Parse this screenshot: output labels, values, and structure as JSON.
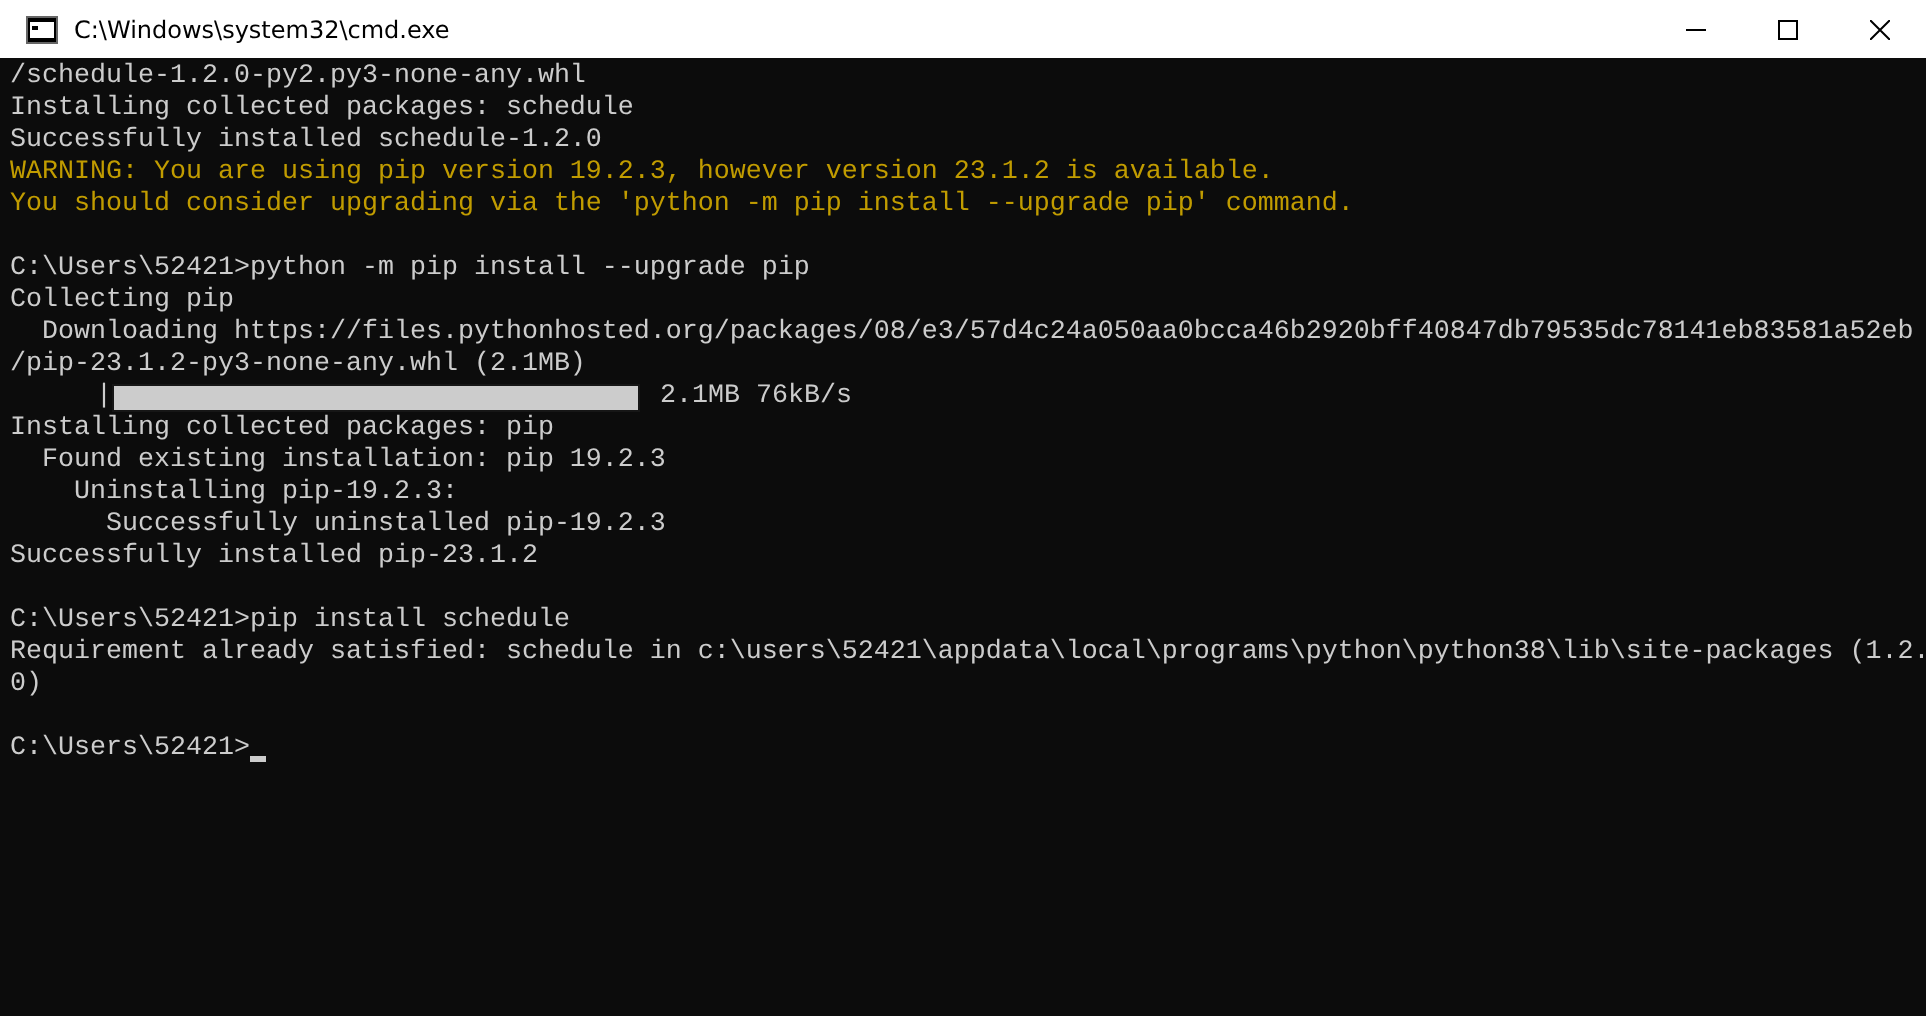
{
  "window": {
    "title": "C:\\Windows\\system32\\cmd.exe"
  },
  "lines": [
    {
      "kind": "output",
      "text": "/schedule-1.2.0-py2.py3-none-any.whl"
    },
    {
      "kind": "output",
      "text": "Installing collected packages: schedule"
    },
    {
      "kind": "output",
      "text": "Successfully installed schedule-1.2.0"
    },
    {
      "kind": "warning",
      "text": "WARNING: You are using pip version 19.2.3, however version 23.1.2 is available."
    },
    {
      "kind": "warning",
      "text": "You should consider upgrading via the 'python -m pip install --upgrade pip' command."
    },
    {
      "kind": "blank"
    },
    {
      "kind": "output",
      "text": "C:\\Users\\52421>python -m pip install --upgrade pip"
    },
    {
      "kind": "output",
      "text": "Collecting pip"
    },
    {
      "kind": "output",
      "text": "  Downloading https://files.pythonhosted.org/packages/08/e3/57d4c24a050aa0bcca46b2920bff40847db79535dc78141eb83581a52eb"
    },
    {
      "kind": "output",
      "text": "/pip-23.1.2-py3-none-any.whl (2.1MB)"
    },
    {
      "kind": "progress",
      "text": "|",
      "level": 1,
      "reading": "2.1MB 76kB/s"
    },
    {
      "kind": "output",
      "text": "Installing collected packages: pip"
    },
    {
      "kind": "output",
      "text": "  Found existing installation: pip 19.2.3"
    },
    {
      "kind": "output",
      "text": "    Uninstalling pip-19.2.3:"
    },
    {
      "kind": "output",
      "text": "      Successfully uninstalled pip-19.2.3"
    },
    {
      "kind": "output",
      "text": "Successfully installed pip-23.1.2"
    },
    {
      "kind": "blank"
    },
    {
      "kind": "output",
      "text": "C:\\Users\\52421>pip install schedule"
    },
    {
      "kind": "output",
      "text": "Requirement already satisfied: schedule in c:\\users\\52421\\appdata\\local\\programs\\python\\python38\\lib\\site-packages (1.2."
    },
    {
      "kind": "output",
      "text": "0)"
    },
    {
      "kind": "blank"
    },
    {
      "kind": "prompt",
      "text": "C:\\Users\\52421>"
    }
  ]
}
